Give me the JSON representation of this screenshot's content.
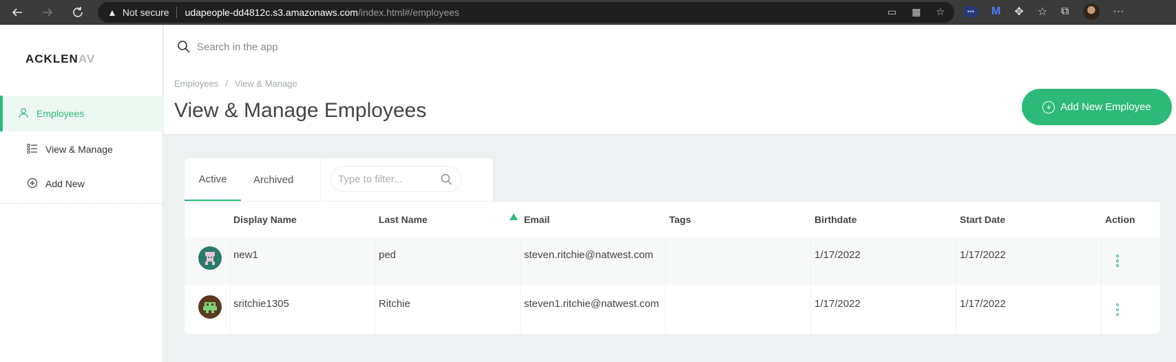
{
  "browser": {
    "security_label": "Not secure",
    "url_host": "udapeople-dd4812c.s3.amazonaws.com",
    "url_path": "/index.html#/employees"
  },
  "app": {
    "logo_text": "ACKLEN",
    "logo_fade": "AV"
  },
  "sidebar": {
    "items": [
      {
        "label": "Employees",
        "icon": "user-icon",
        "active": true
      },
      {
        "label": "View & Manage",
        "icon": "list-icon",
        "active": false
      },
      {
        "label": "Add New",
        "icon": "plus-circle-icon",
        "active": false
      }
    ]
  },
  "search": {
    "placeholder": "Search in the app"
  },
  "breadcrumb": {
    "parent": "Employees",
    "separator": "/",
    "current": "View & Manage"
  },
  "page": {
    "title": "View & Manage Employees",
    "add_button_label": "Add New Employee"
  },
  "tabs": [
    {
      "label": "Active",
      "active": true
    },
    {
      "label": "Archived",
      "active": false
    }
  ],
  "filter": {
    "placeholder": "Type to filter..."
  },
  "table": {
    "columns": [
      "Display Name",
      "Last Name",
      "Email",
      "Tags",
      "Birthdate",
      "Start Date",
      "Action"
    ],
    "sorted_column": "Email",
    "rows": [
      {
        "display_name": "new1",
        "last_name": "ped",
        "email": "steven.ritchie@natwest.com",
        "tags": "",
        "birthdate": "1/17/2022",
        "start_date": "1/17/2022",
        "avatar": "avatar-teal-pixel"
      },
      {
        "display_name": "sritchie1305",
        "last_name": "Ritchie",
        "email": "steven1.ritchie@natwest.com",
        "tags": "",
        "birthdate": "1/17/2022",
        "start_date": "1/17/2022",
        "avatar": "avatar-green-pixel"
      }
    ]
  },
  "colors": {
    "accent": "#2dba78",
    "chrome": "#3b3b3b"
  }
}
